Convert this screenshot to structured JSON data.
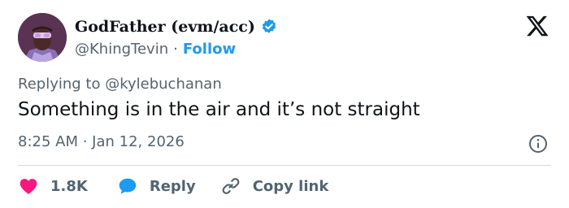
{
  "author": {
    "display_name": "GodFather (evm/acc)",
    "handle": "@KhingTevin",
    "separator": "·",
    "follow_label": "Follow",
    "verified": true
  },
  "tweet": {
    "replying_to": "Replying to @kylebuchanan",
    "text": "Something is in the air and it’s not straight",
    "time": "8:25 AM",
    "date_separator": " · ",
    "date": "Jan 12, 2026"
  },
  "actions": {
    "like_count": "1.8K",
    "reply_label": "Reply",
    "copy_link_label": "Copy link"
  },
  "colors": {
    "accent": "#1d9bf0",
    "like": "#f91880",
    "text": "#0f1419",
    "secondary": "#536471"
  },
  "icons": [
    "verified-badge-icon",
    "x-logo-icon",
    "info-icon",
    "heart-icon",
    "speech-bubble-icon",
    "link-icon"
  ]
}
